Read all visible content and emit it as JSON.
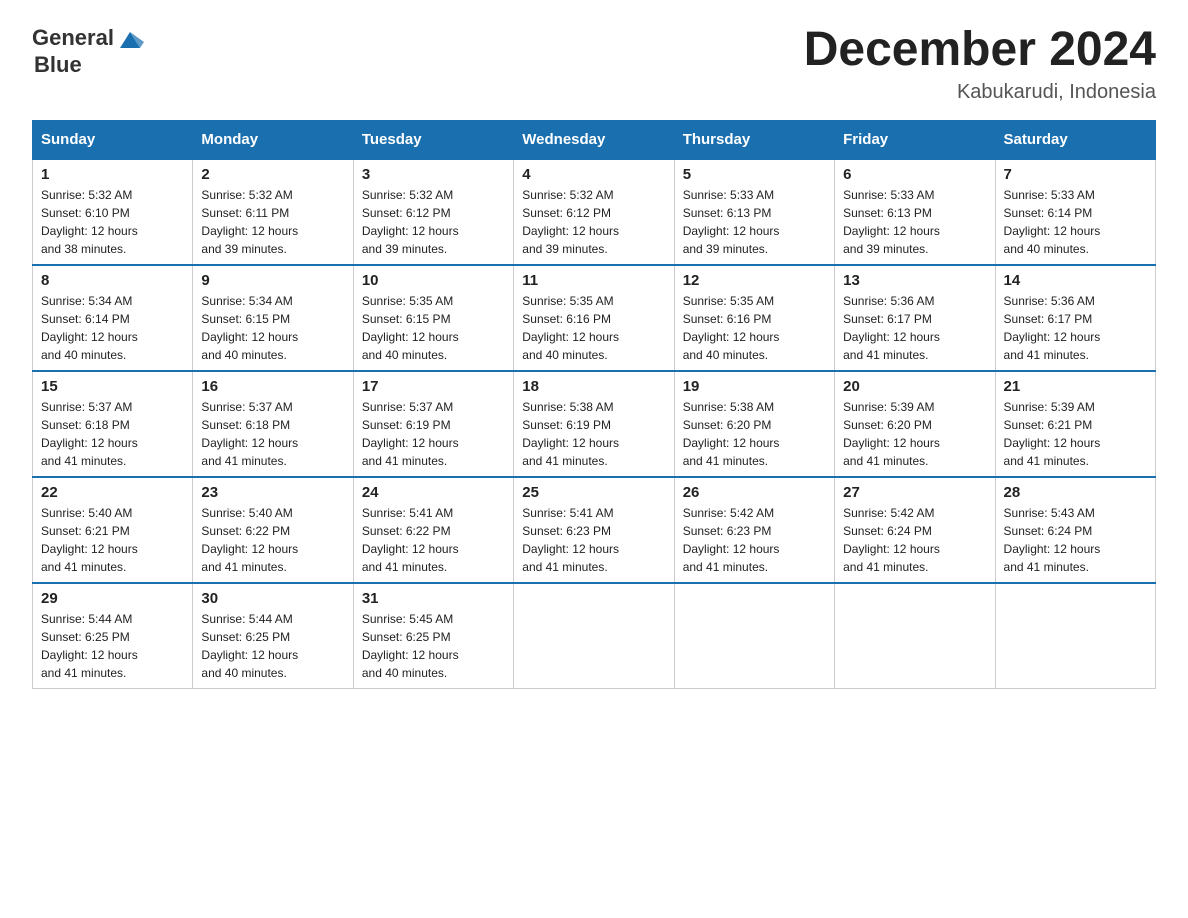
{
  "header": {
    "logo_general": "General",
    "logo_blue": "Blue",
    "month_title": "December 2024",
    "location": "Kabukarudi, Indonesia"
  },
  "days_of_week": [
    "Sunday",
    "Monday",
    "Tuesday",
    "Wednesday",
    "Thursday",
    "Friday",
    "Saturday"
  ],
  "weeks": [
    [
      {
        "day": "1",
        "sunrise": "5:32 AM",
        "sunset": "6:10 PM",
        "daylight": "12 hours and 38 minutes."
      },
      {
        "day": "2",
        "sunrise": "5:32 AM",
        "sunset": "6:11 PM",
        "daylight": "12 hours and 39 minutes."
      },
      {
        "day": "3",
        "sunrise": "5:32 AM",
        "sunset": "6:12 PM",
        "daylight": "12 hours and 39 minutes."
      },
      {
        "day": "4",
        "sunrise": "5:32 AM",
        "sunset": "6:12 PM",
        "daylight": "12 hours and 39 minutes."
      },
      {
        "day": "5",
        "sunrise": "5:33 AM",
        "sunset": "6:13 PM",
        "daylight": "12 hours and 39 minutes."
      },
      {
        "day": "6",
        "sunrise": "5:33 AM",
        "sunset": "6:13 PM",
        "daylight": "12 hours and 39 minutes."
      },
      {
        "day": "7",
        "sunrise": "5:33 AM",
        "sunset": "6:14 PM",
        "daylight": "12 hours and 40 minutes."
      }
    ],
    [
      {
        "day": "8",
        "sunrise": "5:34 AM",
        "sunset": "6:14 PM",
        "daylight": "12 hours and 40 minutes."
      },
      {
        "day": "9",
        "sunrise": "5:34 AM",
        "sunset": "6:15 PM",
        "daylight": "12 hours and 40 minutes."
      },
      {
        "day": "10",
        "sunrise": "5:35 AM",
        "sunset": "6:15 PM",
        "daylight": "12 hours and 40 minutes."
      },
      {
        "day": "11",
        "sunrise": "5:35 AM",
        "sunset": "6:16 PM",
        "daylight": "12 hours and 40 minutes."
      },
      {
        "day": "12",
        "sunrise": "5:35 AM",
        "sunset": "6:16 PM",
        "daylight": "12 hours and 40 minutes."
      },
      {
        "day": "13",
        "sunrise": "5:36 AM",
        "sunset": "6:17 PM",
        "daylight": "12 hours and 41 minutes."
      },
      {
        "day": "14",
        "sunrise": "5:36 AM",
        "sunset": "6:17 PM",
        "daylight": "12 hours and 41 minutes."
      }
    ],
    [
      {
        "day": "15",
        "sunrise": "5:37 AM",
        "sunset": "6:18 PM",
        "daylight": "12 hours and 41 minutes."
      },
      {
        "day": "16",
        "sunrise": "5:37 AM",
        "sunset": "6:18 PM",
        "daylight": "12 hours and 41 minutes."
      },
      {
        "day": "17",
        "sunrise": "5:37 AM",
        "sunset": "6:19 PM",
        "daylight": "12 hours and 41 minutes."
      },
      {
        "day": "18",
        "sunrise": "5:38 AM",
        "sunset": "6:19 PM",
        "daylight": "12 hours and 41 minutes."
      },
      {
        "day": "19",
        "sunrise": "5:38 AM",
        "sunset": "6:20 PM",
        "daylight": "12 hours and 41 minutes."
      },
      {
        "day": "20",
        "sunrise": "5:39 AM",
        "sunset": "6:20 PM",
        "daylight": "12 hours and 41 minutes."
      },
      {
        "day": "21",
        "sunrise": "5:39 AM",
        "sunset": "6:21 PM",
        "daylight": "12 hours and 41 minutes."
      }
    ],
    [
      {
        "day": "22",
        "sunrise": "5:40 AM",
        "sunset": "6:21 PM",
        "daylight": "12 hours and 41 minutes."
      },
      {
        "day": "23",
        "sunrise": "5:40 AM",
        "sunset": "6:22 PM",
        "daylight": "12 hours and 41 minutes."
      },
      {
        "day": "24",
        "sunrise": "5:41 AM",
        "sunset": "6:22 PM",
        "daylight": "12 hours and 41 minutes."
      },
      {
        "day": "25",
        "sunrise": "5:41 AM",
        "sunset": "6:23 PM",
        "daylight": "12 hours and 41 minutes."
      },
      {
        "day": "26",
        "sunrise": "5:42 AM",
        "sunset": "6:23 PM",
        "daylight": "12 hours and 41 minutes."
      },
      {
        "day": "27",
        "sunrise": "5:42 AM",
        "sunset": "6:24 PM",
        "daylight": "12 hours and 41 minutes."
      },
      {
        "day": "28",
        "sunrise": "5:43 AM",
        "sunset": "6:24 PM",
        "daylight": "12 hours and 41 minutes."
      }
    ],
    [
      {
        "day": "29",
        "sunrise": "5:44 AM",
        "sunset": "6:25 PM",
        "daylight": "12 hours and 41 minutes."
      },
      {
        "day": "30",
        "sunrise": "5:44 AM",
        "sunset": "6:25 PM",
        "daylight": "12 hours and 40 minutes."
      },
      {
        "day": "31",
        "sunrise": "5:45 AM",
        "sunset": "6:25 PM",
        "daylight": "12 hours and 40 minutes."
      },
      null,
      null,
      null,
      null
    ]
  ],
  "labels": {
    "sunrise": "Sunrise:",
    "sunset": "Sunset:",
    "daylight": "Daylight:"
  }
}
